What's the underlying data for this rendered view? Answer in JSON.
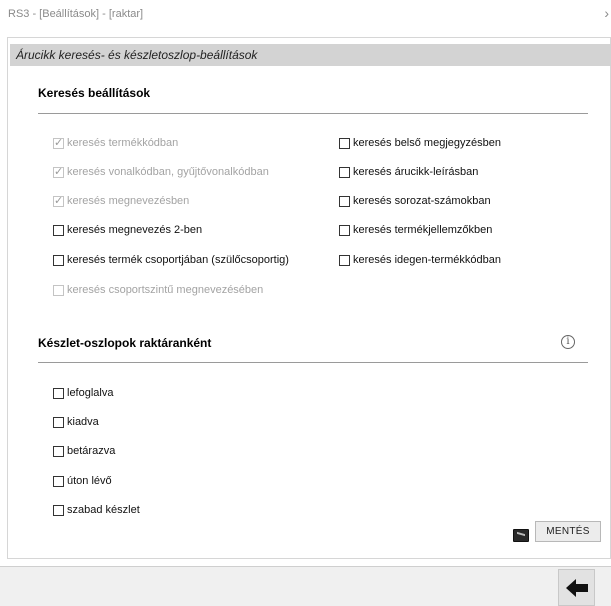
{
  "window": {
    "title": "RS3 - [Beállítások] - [raktar]",
    "scroll_arrow": "›"
  },
  "panel": {
    "header": "Árucikk keresés- és készletoszlop-beállítások"
  },
  "search_settings": {
    "title": "Keresés beállítások",
    "left_options": [
      {
        "label": "keresés termékkódban",
        "checked": true,
        "disabled": true
      },
      {
        "label": "keresés vonalkódban, gyűjtővonalkódban",
        "checked": true,
        "disabled": true
      },
      {
        "label": "keresés megnevezésben",
        "checked": true,
        "disabled": true
      },
      {
        "label": "keresés megnevezés 2-ben",
        "checked": false,
        "disabled": false
      },
      {
        "label": "keresés termék csoportjában (szülőcsoportig)",
        "checked": false,
        "disabled": false
      },
      {
        "label": "keresés csoportszintű megnevezésében",
        "checked": false,
        "disabled": true
      }
    ],
    "right_options": [
      {
        "label": "keresés belső megjegyzésben",
        "checked": false,
        "disabled": false
      },
      {
        "label": "keresés árucikk-leírásban",
        "checked": false,
        "disabled": false
      },
      {
        "label": "keresés sorozat-számokban",
        "checked": false,
        "disabled": false
      },
      {
        "label": "keresés termékjellemzőkben",
        "checked": false,
        "disabled": false
      },
      {
        "label": "keresés idegen-termékkódban",
        "checked": false,
        "disabled": false
      }
    ]
  },
  "stock_columns": {
    "title": "Készlet-oszlopok raktáranként",
    "info_icon": "i",
    "options": [
      {
        "label": "lefoglalva",
        "checked": false
      },
      {
        "label": "kiadva",
        "checked": false
      },
      {
        "label": "betárazva",
        "checked": false
      },
      {
        "label": "úton lévő",
        "checked": false
      },
      {
        "label": "szabad készlet",
        "checked": false
      }
    ]
  },
  "actions": {
    "save_label": "MENTÉS",
    "monitor_icon": "monitor-icon",
    "back_icon": "arrow-left-icon"
  },
  "colors": {
    "header_bg": "#d3d3d3",
    "footer_bg": "#f0f0f0"
  }
}
